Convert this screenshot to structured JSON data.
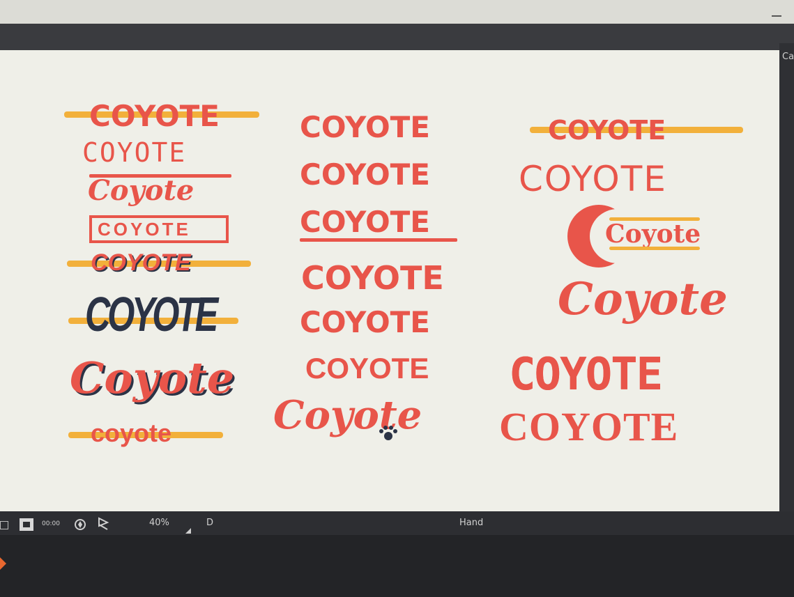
{
  "canvas_text": {
    "col1": [
      "COYOTE",
      "COYOTE",
      "Coyote",
      "COYOTE",
      "COYOTE",
      "COYOTE",
      "Coyote",
      "coyote"
    ],
    "col2": [
      "COYOTE",
      "COYOTE",
      "COYOTE",
      "COYOTE",
      "COYOTE",
      "COYOTE",
      "Coyote"
    ],
    "col3": [
      "COYOTE",
      "COYOTE",
      "Coyote",
      "Coyote",
      "COYOTE",
      "COYOTE"
    ]
  },
  "status": {
    "zoom": "40%",
    "key": "D",
    "tool": "Hand",
    "time": "00:00"
  },
  "panel": {
    "label": "Ca"
  },
  "icons": [
    "frame-icon",
    "screen-mode-icon",
    "timecode-icon",
    "rotate-view-icon",
    "flip-icon",
    "zoom-dropdown-icon",
    "minimize-icon",
    "paw-icon"
  ],
  "colors": {
    "coral": "#e8554a",
    "gold": "#f2b03b",
    "navy": "#2b3346",
    "canvas": "#efefe8"
  }
}
